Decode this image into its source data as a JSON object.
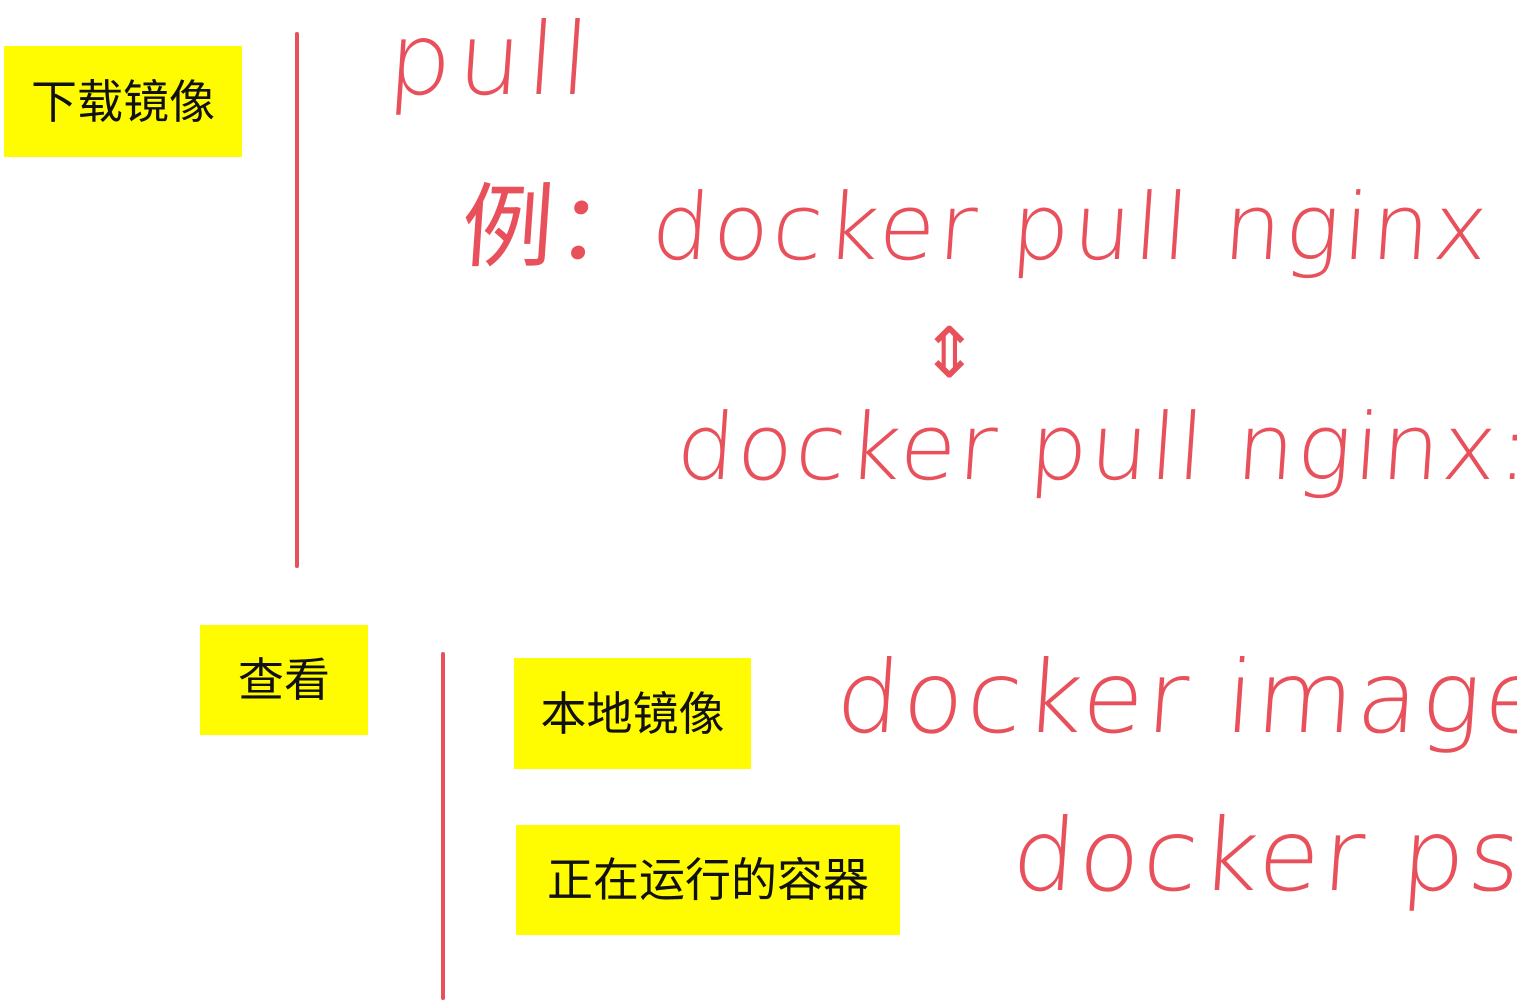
{
  "labels": {
    "download": "下载镜像",
    "view": "查看",
    "local_images": "本地镜像",
    "running_containers": "正在运行的容器"
  },
  "handwriting": {
    "pull": "pull",
    "example": "例：docker pull nginx",
    "equivalence_arrow": "⇕",
    "example_latest": "docker pull nginx:latest",
    "images_cmd": "docker images",
    "ps_cmd": "docker ps"
  },
  "colors": {
    "highlight": "#fffb00",
    "ink": "#e8505b",
    "label_text": "#111111",
    "background": "#ffffff"
  }
}
